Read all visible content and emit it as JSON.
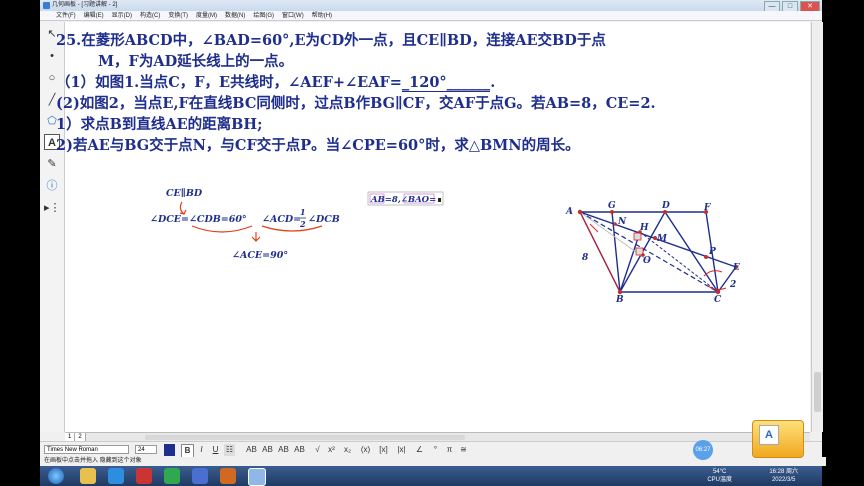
{
  "window": {
    "title": "几何画板 - [习题讲解 - 2]",
    "min": "—",
    "max": "□",
    "close": "✕"
  },
  "menu": [
    "文件(F)",
    "编辑(E)",
    "显示(D)",
    "构造(C)",
    "变换(T)",
    "度量(M)",
    "数据(N)",
    "绘图(G)",
    "窗口(W)",
    "帮助(H)"
  ],
  "tools": [
    "↖",
    "•",
    "○",
    "╱",
    "⬠",
    "A",
    "✎",
    "ⓘ",
    "▸⋮"
  ],
  "problem": {
    "line1": "25.在菱形ABCD中，∠BAD=60°,E为CD外一点，且CE∥BD，连接AE交BD于点",
    "line2": "M，F为AD延长线上的一点。",
    "line3_pre": "（1）如图1.当点C，F，E共线时，∠AEF+∠EAF=",
    "line3_ans": "_120°______",
    "line3_post": ".",
    "line4": "(2)如图2，当点E,F在直线BC同侧时，过点B作BG∥CF，交AF于点G。若AB=8，CE=2.",
    "line5": "1）求点B到直线AE的距离BH;",
    "line6": "2)若AE与BG交于点N，与CF交于点P。当∠CPE=60°时，求△BMN的周长。"
  },
  "notes": {
    "parallel": "CE∥BD",
    "eq1": "∠DCE=∠CDB=60°",
    "eq2_left": "∠ACD=",
    "eq2_num": "1",
    "eq2_den": "2",
    "eq2_right": "∠DCB",
    "eq3": "∠ACE=90°",
    "measure": "AB=8,∠BAO="
  },
  "figure": {
    "labels": {
      "A": "A",
      "B": "B",
      "C": "C",
      "D": "D",
      "E": "E",
      "F": "F",
      "G": "G",
      "H": "H",
      "M": "M",
      "N": "N",
      "O": "O",
      "P": "P"
    },
    "len_ab": "8",
    "len_ce": "2"
  },
  "pages": [
    "1",
    "2"
  ],
  "format": {
    "font": "Times New Roman",
    "size": "24",
    "bold": "B",
    "italic": "I",
    "underline": "U",
    "symbols": [
      "AB",
      "AB",
      "AB",
      "AB",
      "√",
      "x²",
      "x₂",
      "(x)",
      "[x]",
      "|x|",
      "∠",
      "°",
      "π",
      "≅"
    ]
  },
  "status": "在画板中点击并拖入 隐藏到这个对象",
  "time_badge": "06:27",
  "tray": {
    "temp": "54°C",
    "temp_label": "CPU温度",
    "time": "16:28 周六",
    "date": "2022/3/5"
  },
  "widget_letter": "A"
}
